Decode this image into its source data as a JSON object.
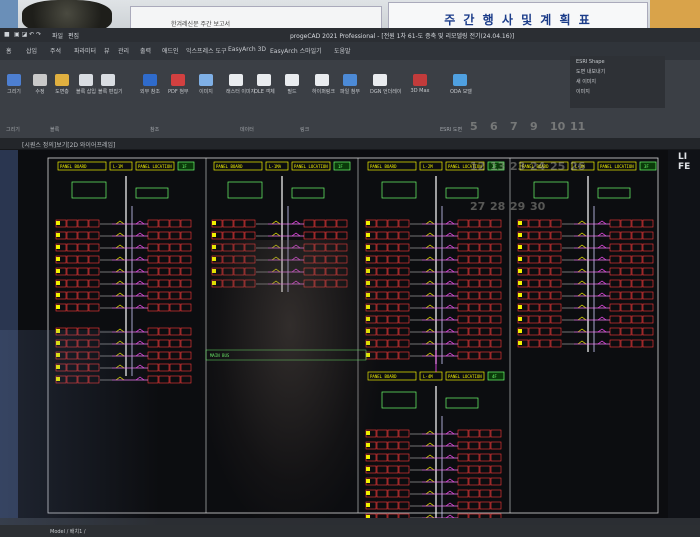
{
  "environment": {
    "sign_left": "한겨레신문 주간 보고서",
    "sign_right": "주 간 행 사 및 계 획 표"
  },
  "app": {
    "title": "progeCAD 2021 Professional - [전원 1차 61-도 증축 및 리모델링 전기(24.04.16)]",
    "menu": [
      "파일",
      "편집",
      "보기",
      "삽입",
      "형식",
      "도구",
      "그리기",
      "치수",
      "수정",
      "창",
      "도움말"
    ],
    "ribbon_tabs": [
      "홈",
      "삽입",
      "주석",
      "파라미터",
      "뷰",
      "관리",
      "출력",
      "애드인",
      "익스프레스 도구",
      "EasyArch 3D",
      "EasyArch 스마일기",
      "도움말"
    ],
    "tools": [
      {
        "label": "그리기",
        "color": "#4d7fd1"
      },
      {
        "label": "수정",
        "color": "#c9c9c9"
      },
      {
        "label": "도면층",
        "color": "#e0b040"
      },
      {
        "label": "블록 삽입",
        "color": "#d9dde2"
      },
      {
        "label": "블록 편집기",
        "color": "#d9dde2"
      },
      {
        "label": "외부 참조",
        "color": "#2f6bcb"
      },
      {
        "label": "PDF 첨부",
        "color": "#d24040"
      },
      {
        "label": "이미지",
        "color": "#7fb0e6"
      },
      {
        "label": "래스터 이미지",
        "color": "#e9ecef"
      },
      {
        "label": "OLE 객체",
        "color": "#e9ecef"
      },
      {
        "label": "필드",
        "color": "#e9ecef"
      },
      {
        "label": "하이퍼링크",
        "color": "#e9ecef"
      },
      {
        "label": "파일 첨부",
        "color": "#4c8ad6"
      },
      {
        "label": "DGN 언더레이",
        "color": "#e9ecef"
      },
      {
        "label": "3D Max",
        "color": "#c23b3b"
      },
      {
        "label": "ODA 모델",
        "color": "#4fa0e0"
      }
    ],
    "tool_groups": [
      "그리기",
      "블록",
      "참조",
      "데이터",
      "링크",
      "ESRI 도면"
    ],
    "right_panel": [
      "ESRI Shape",
      "도면 내보내기",
      "새 이미지",
      "이미지"
    ],
    "document_tab": "[시퀀스 정의]보기[2D 와이어프레임]",
    "status_tabs": "Model / 배치1 /",
    "right_dock": [
      "LI",
      "FE"
    ]
  },
  "drawing": {
    "panels": [
      {
        "header": "PANEL BOARD",
        "mid": "L-1M",
        "loc": "PANEL LOCATION",
        "tag": "1F"
      },
      {
        "header": "PANEL BOARD",
        "mid": "L-1MA",
        "loc": "PANEL LOCATION",
        "tag": "1F"
      },
      {
        "header": "PANEL BOARD",
        "mid": "L-2M",
        "loc": "PANEL LOCATION",
        "tag": "2F"
      },
      {
        "header": "PANEL BOARD",
        "mid": "L-3M",
        "loc": "PANEL LOCATION",
        "tag": "3F"
      },
      {
        "header": "PANEL BOARD",
        "mid": "L-4M",
        "loc": "PANEL LOCATION",
        "tag": "4F"
      }
    ],
    "bus_label": "MAIN BUS"
  },
  "calendar_reflection": [
    "5",
    "6",
    "7",
    "9",
    "10",
    "11",
    "12",
    "13",
    "23",
    "24",
    "25",
    "26",
    "27",
    "28",
    "29",
    "30"
  ]
}
